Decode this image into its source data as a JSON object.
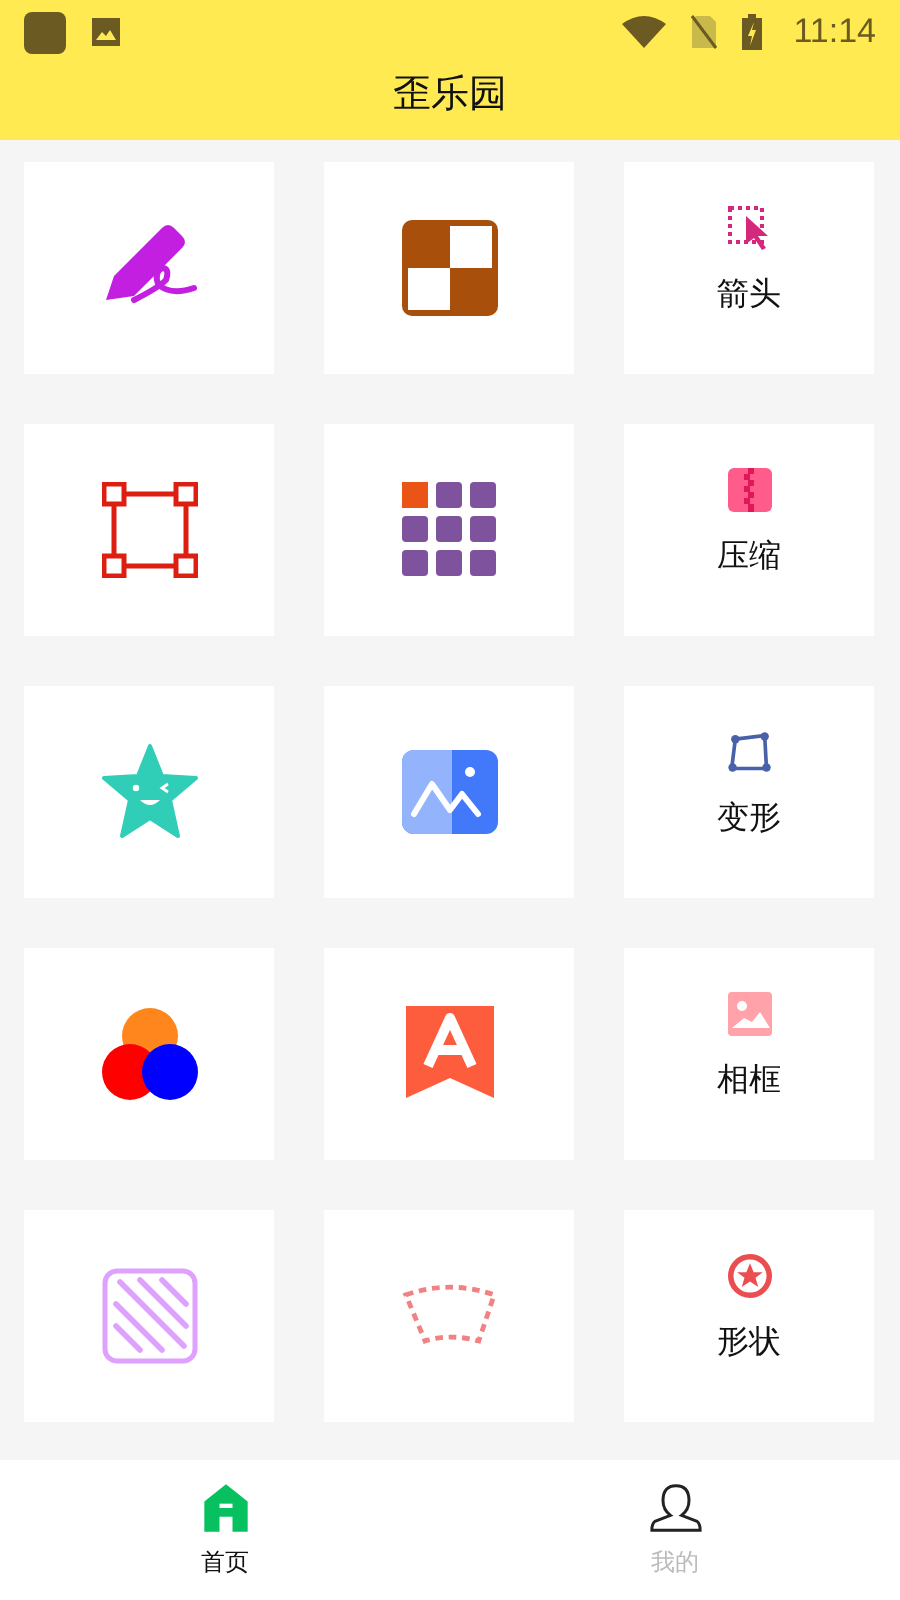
{
  "status_bar": {
    "time": "11:14"
  },
  "title": "歪乐园",
  "tiles": [
    {
      "kind": "pencil"
    },
    {
      "kind": "checker"
    },
    {
      "kind": "arrow",
      "label": "箭头"
    },
    {
      "kind": "frame"
    },
    {
      "kind": "grid"
    },
    {
      "kind": "zip",
      "label": "压缩"
    },
    {
      "kind": "star"
    },
    {
      "kind": "image"
    },
    {
      "kind": "transform",
      "label": "变形"
    },
    {
      "kind": "circles"
    },
    {
      "kind": "banner"
    },
    {
      "kind": "photo",
      "label": "相框"
    },
    {
      "kind": "stripes"
    },
    {
      "kind": "arc"
    },
    {
      "kind": "badge",
      "label": "形状"
    }
  ],
  "nav": [
    {
      "kind": "home",
      "label": "首页",
      "selected": true
    },
    {
      "kind": "user",
      "label": "我的",
      "selected": false
    }
  ]
}
